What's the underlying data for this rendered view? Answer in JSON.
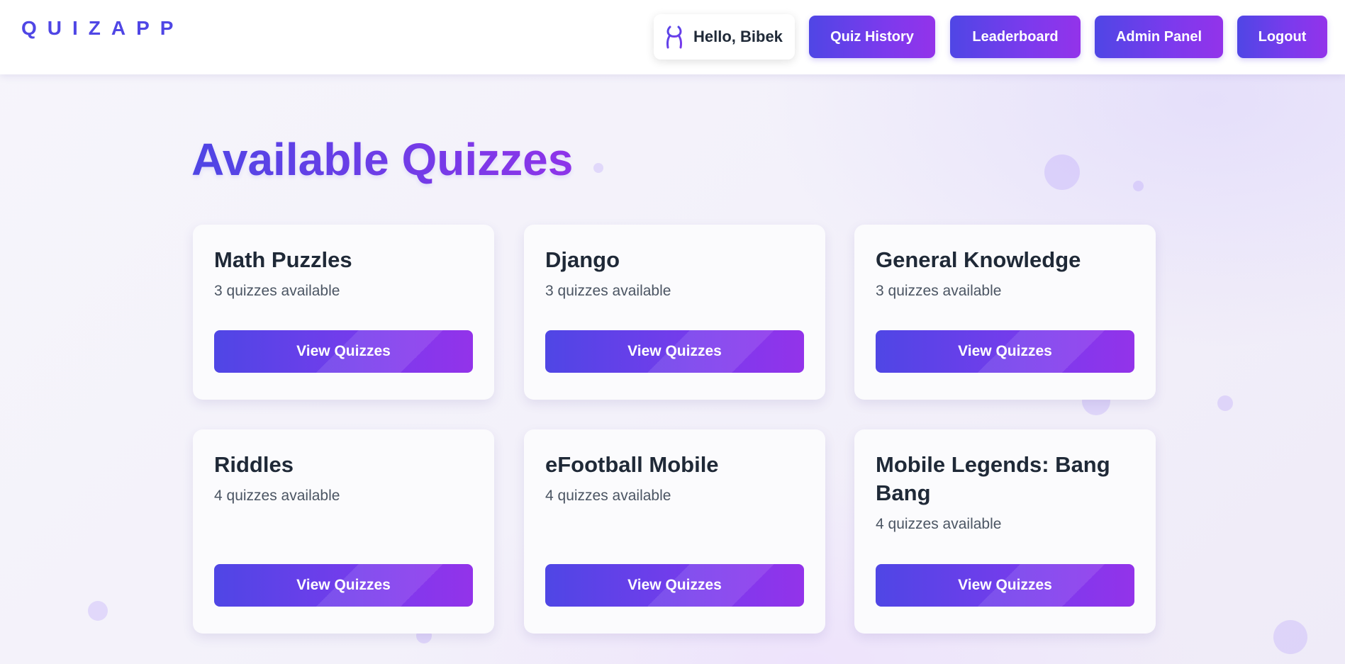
{
  "header": {
    "logo": "QUIZAPP",
    "greeting": "Hello, Bibek",
    "nav": {
      "quiz_history": "Quiz History",
      "leaderboard": "Leaderboard",
      "admin_panel": "Admin Panel",
      "logout": "Logout"
    }
  },
  "main": {
    "title": "Available Quizzes",
    "categories": [
      {
        "name": "Math Puzzles",
        "count": "3 quizzes available",
        "button": "View Quizzes"
      },
      {
        "name": "Django",
        "count": "3 quizzes available",
        "button": "View Quizzes"
      },
      {
        "name": "General Knowledge",
        "count": "3 quizzes available",
        "button": "View Quizzes"
      },
      {
        "name": "Riddles",
        "count": "4 quizzes available",
        "button": "View Quizzes"
      },
      {
        "name": "eFootball Mobile",
        "count": "4 quizzes available",
        "button": "View Quizzes"
      },
      {
        "name": "Mobile Legends: Bang Bang",
        "count": "4 quizzes available",
        "button": "View Quizzes"
      }
    ]
  },
  "colors": {
    "accent_start": "#4f46e5",
    "accent_end": "#9333ea",
    "text_dark": "#1f2937",
    "text_muted": "#4b5563"
  },
  "icons": {
    "user": "user-icon"
  }
}
